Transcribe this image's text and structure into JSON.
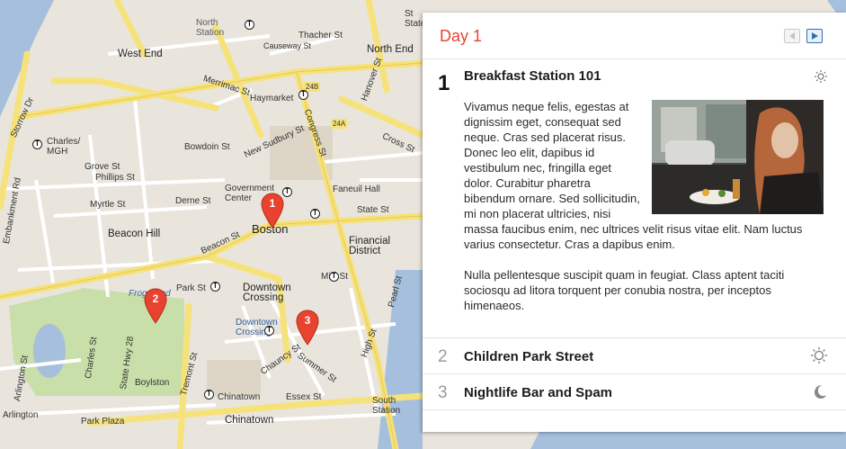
{
  "map": {
    "labels": {
      "north_station": "North Station",
      "west_end": "West End",
      "north_end": "North End",
      "thacher_st": "Thacher St",
      "causeway_st": "Causeway St",
      "merrimac_st": "Merrimac St",
      "haymarket": "Haymarket",
      "storrow_dr": "Storrow Dr",
      "charles_mgh": "Charles/ MGH",
      "bowdoin_st": "Bowdoin St",
      "new_sudbury_st": "New Sudbury St",
      "congress_st": "Congress St",
      "hanover_st": "Hanover St",
      "cross_st": "Cross St",
      "grove_st": "Grove St",
      "phillips_st": "Phillips St",
      "myrtle_st": "Myrtle St",
      "derne_st": "Derne St",
      "government_center": "Government Center",
      "faneuil_hall": "Faneuil Hall",
      "state_st": "State St",
      "beacon_hill": "Beacon Hill",
      "boston": "Boston",
      "financial_district": "Financial District",
      "beacon_st": "Beacon St",
      "park_st": "Park St",
      "downtown_crossing": "Downtown Crossing",
      "downtown_crossing_t": "Downtown Crossing",
      "milk_st": "Milk St",
      "frog_pond": "Frog Pond",
      "charles_st": "Charles St",
      "state_hwy_28": "State Hwy 28",
      "tremont_st": "Tremont St",
      "arlington_st": "Arlington St",
      "boylston": "Boylston",
      "chinatown_t": "Chinatown",
      "chinatown": "Chinatown",
      "essex_st": "Essex St",
      "south_station": "South Station",
      "arlington": "Arlington",
      "park_plaza": "Park Plaza",
      "summer_st": "Summer St",
      "pearl_st": "Pearl St",
      "high_st": "High St",
      "chauncy_st": "Chauncy St",
      "embankment_rd": "Embankment Rd",
      "st_state": "St State",
      "route_24b": "24B",
      "route_24a": "24A"
    },
    "markers": [
      {
        "label": "1"
      },
      {
        "label": "2"
      },
      {
        "label": "3"
      }
    ],
    "transit_symbol": "T"
  },
  "panel": {
    "day_title": "Day 1",
    "prev_icon": "triangle-left",
    "next_icon": "triangle-right",
    "accent_color": "#e8432f",
    "items": [
      {
        "number": "1",
        "title": "Breakfast Station 101",
        "icon": "sun-icon",
        "paragraph1": "Vivamus neque felis, egestas at dignissim eget, consequat sed neque. Cras sed placerat risus. Donec leo elit, dapibus id vestibulum nec, fringilla eget dolor. Curabitur pharetra bibendum ornare. Sed sollicitudin, mi non placerat ultricies, nisi massa faucibus enim, nec ultrices velit risus vitae elit. Nam luctus varius consectetur. Cras a dapibus enim.",
        "paragraph2": "Nulla pellentesque suscipit quam in feugiat. Class aptent taciti sociosqu ad litora torquent per conubia nostra, per inceptos himenaeos."
      },
      {
        "number": "2",
        "title": "Children Park Street",
        "icon": "sun-icon"
      },
      {
        "number": "3",
        "title": "Nightlife Bar and Spam",
        "icon": "moon-icon"
      }
    ]
  }
}
